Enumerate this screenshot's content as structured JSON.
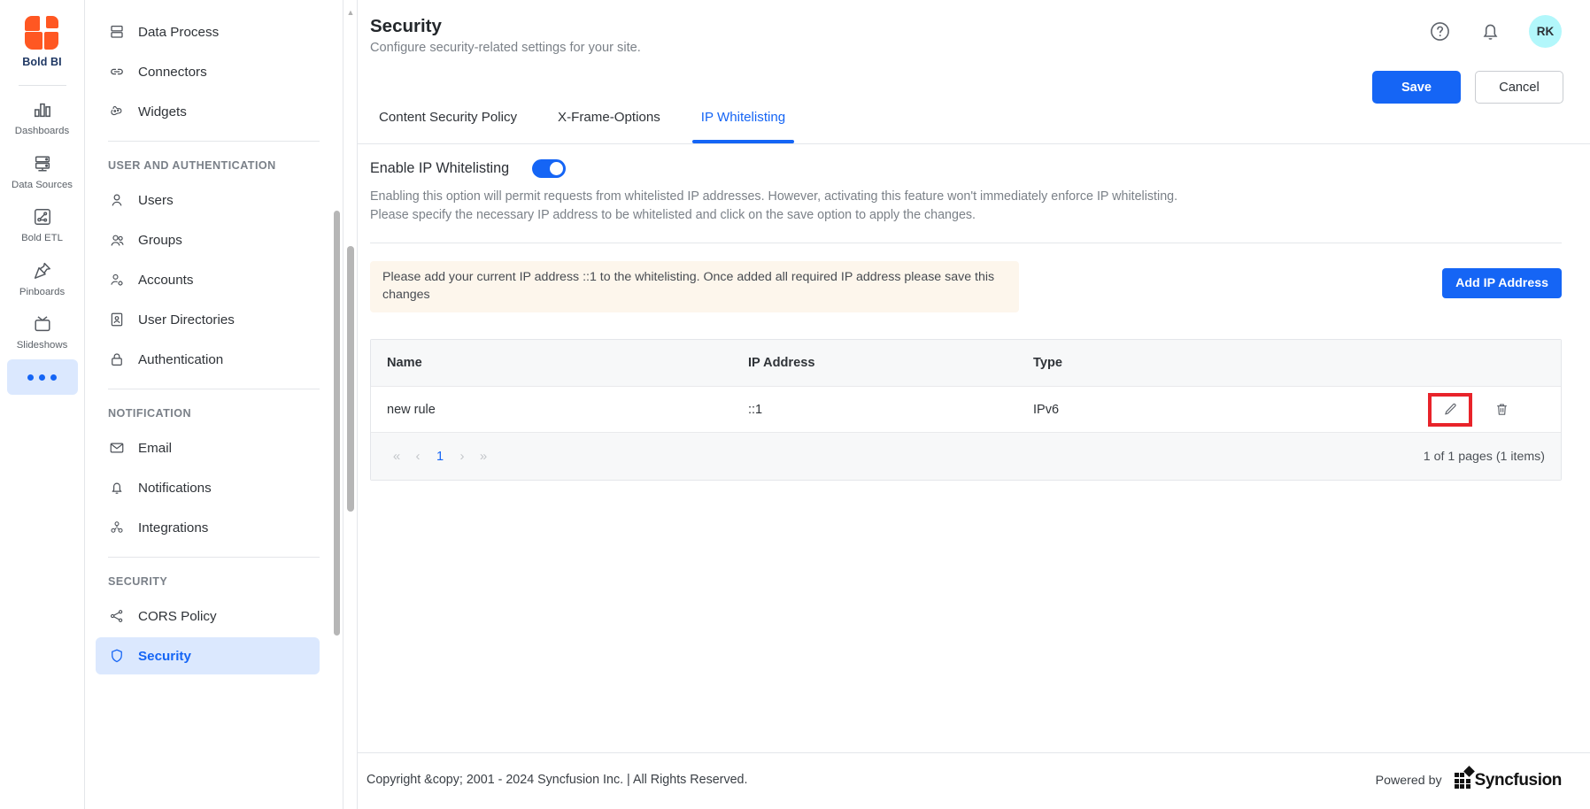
{
  "brand": {
    "name": "Bold BI"
  },
  "rail": {
    "items": [
      {
        "label": "Dashboards",
        "icon": "bar-chart-icon",
        "active": false
      },
      {
        "label": "Data Sources",
        "icon": "database-icon",
        "active": false
      },
      {
        "label": "Bold ETL",
        "icon": "etl-icon",
        "active": false
      },
      {
        "label": "Pinboards",
        "icon": "pin-icon",
        "active": false
      },
      {
        "label": "Slideshows",
        "icon": "tv-icon",
        "active": false
      },
      {
        "label": "",
        "icon": "more-dots-icon",
        "active": true
      }
    ]
  },
  "sidebar": {
    "items": [
      {
        "label": "Data Process",
        "icon": "data-process-icon"
      },
      {
        "label": "Connectors",
        "icon": "link-icon"
      },
      {
        "label": "Widgets",
        "icon": "widgets-icon"
      }
    ],
    "groups": [
      {
        "title": "USER AND AUTHENTICATION",
        "items": [
          {
            "label": "Users",
            "icon": "user-icon"
          },
          {
            "label": "Groups",
            "icon": "users-group-icon"
          },
          {
            "label": "Accounts",
            "icon": "account-gear-icon"
          },
          {
            "label": "User Directories",
            "icon": "id-card-icon"
          },
          {
            "label": "Authentication",
            "icon": "lock-icon"
          }
        ]
      },
      {
        "title": "NOTIFICATION",
        "items": [
          {
            "label": "Email",
            "icon": "envelope-icon"
          },
          {
            "label": "Notifications",
            "icon": "bell-icon"
          },
          {
            "label": "Integrations",
            "icon": "integrations-icon"
          }
        ]
      },
      {
        "title": "SECURITY",
        "items": [
          {
            "label": "CORS Policy",
            "icon": "share-nodes-icon"
          },
          {
            "label": "Security",
            "icon": "shield-icon",
            "active": true
          }
        ]
      }
    ]
  },
  "header": {
    "title": "Security",
    "subtitle": "Configure security-related settings for your site.",
    "help_icon": "help-circle-icon",
    "bell_icon": "bell-icon",
    "avatar_initials": "RK",
    "avatar_color": "#b2f7fb",
    "save_label": "Save",
    "cancel_label": "Cancel"
  },
  "tabs": [
    {
      "label": "Content Security Policy",
      "active": false
    },
    {
      "label": "X-Frame-Options",
      "active": false
    },
    {
      "label": "IP Whitelisting",
      "active": true
    }
  ],
  "ip_whitelisting": {
    "toggle_label": "Enable IP Whitelisting",
    "toggle_on": true,
    "description_line1": "Enabling this option will permit requests from whitelisted IP addresses. However, activating this feature won't immediately enforce IP whitelisting.",
    "description_line2": "Please specify the necessary IP address to be whitelisted and click on the save option to apply the changes.",
    "banner_text": "Please add your current IP address ::1 to the whitelisting. Once added all required IP address please save this changes",
    "banner_bg": "#fdf6ec",
    "add_button_label": "Add IP Address",
    "table": {
      "columns": [
        "Name",
        "IP Address",
        "Type"
      ],
      "rows": [
        {
          "name": "new rule",
          "ip_address": "::1",
          "type": "IPv6",
          "edit_icon": "pencil-icon",
          "delete_icon": "trash-icon"
        }
      ],
      "pagination": {
        "first": "«",
        "prev": "‹",
        "page": "1",
        "next": "›",
        "last": "»",
        "info": "1 of 1 pages (1 items)"
      }
    }
  },
  "footer": {
    "copyright": "Copyright &copy; 2001 - 2024 Syncfusion Inc. | All Rights Reserved.",
    "powered_by": "Powered by",
    "logo_word": "Syncfusion"
  },
  "accent": "#1565f5"
}
